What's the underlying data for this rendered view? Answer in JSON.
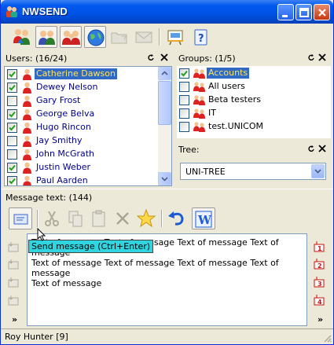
{
  "window": {
    "title": "NWSEND"
  },
  "toolbar": {
    "buttons": [
      {
        "name": "users-icon",
        "pressed": false
      },
      {
        "name": "user-group-icon",
        "pressed": true
      },
      {
        "name": "groups-icon",
        "pressed": true
      },
      {
        "name": "globe-icon",
        "pressed": true
      },
      {
        "name": "folder-icon",
        "pressed": false
      },
      {
        "name": "mail-icon",
        "pressed": false
      },
      {
        "name": "presentation-icon",
        "pressed": false
      },
      {
        "name": "help-icon",
        "pressed": false
      }
    ]
  },
  "users": {
    "header": "Users: (16/24)",
    "items": [
      {
        "label": "Catherine Dawson",
        "checked": true,
        "selected": true
      },
      {
        "label": "Dewey Nelson",
        "checked": true,
        "selected": false
      },
      {
        "label": "Gary Frost",
        "checked": false,
        "selected": false
      },
      {
        "label": "George Belva",
        "checked": true,
        "selected": false
      },
      {
        "label": "Hugo Rincon",
        "checked": true,
        "selected": false
      },
      {
        "label": "Jay Smithy",
        "checked": false,
        "selected": false
      },
      {
        "label": "John McGrath",
        "checked": false,
        "selected": false
      },
      {
        "label": "Justin Weber",
        "checked": true,
        "selected": false
      },
      {
        "label": "Paul Aarden",
        "checked": true,
        "selected": false
      }
    ]
  },
  "groups": {
    "header": "Groups: (1/5)",
    "items": [
      {
        "label": "Accounts",
        "checked": true,
        "selected": true
      },
      {
        "label": "All users",
        "checked": false,
        "selected": false
      },
      {
        "label": "Beta testers",
        "checked": false,
        "selected": false
      },
      {
        "label": "IT",
        "checked": false,
        "selected": false
      },
      {
        "label": "test.UNICOM",
        "checked": false,
        "selected": false
      }
    ]
  },
  "tree": {
    "header": "Tree:",
    "selected": "UNI-TREE"
  },
  "message": {
    "header": "Message text: (144)",
    "text": "Text of message Text of message Text of message Text of message\nText of message Text of message Text of message Text of message\nText of message",
    "tooltip": "Send message (Ctrl+Enter)",
    "more_left": "»",
    "more_right": "»"
  },
  "status": {
    "text": "Roy Hunter [9]"
  },
  "colors": {
    "title_bar": "#0054e3",
    "selection": "#316ac5",
    "selection_text": "#ffe45c",
    "tooltip_bg": "#30d5df"
  }
}
